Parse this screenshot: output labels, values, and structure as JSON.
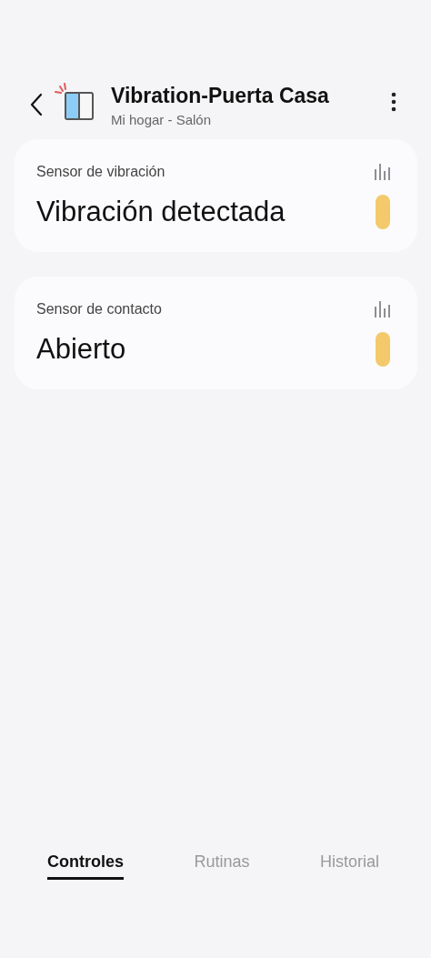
{
  "header": {
    "title": "Vibration-Puerta Casa",
    "subtitle": "Mi hogar - Salón"
  },
  "cards": [
    {
      "label": "Sensor de vibración",
      "value": "Vibración detectada"
    },
    {
      "label": "Sensor de contacto",
      "value": "Abierto"
    }
  ],
  "tabs": [
    {
      "label": "Controles",
      "selected": true
    },
    {
      "label": "Rutinas",
      "selected": false
    },
    {
      "label": "Historial",
      "selected": false
    }
  ]
}
